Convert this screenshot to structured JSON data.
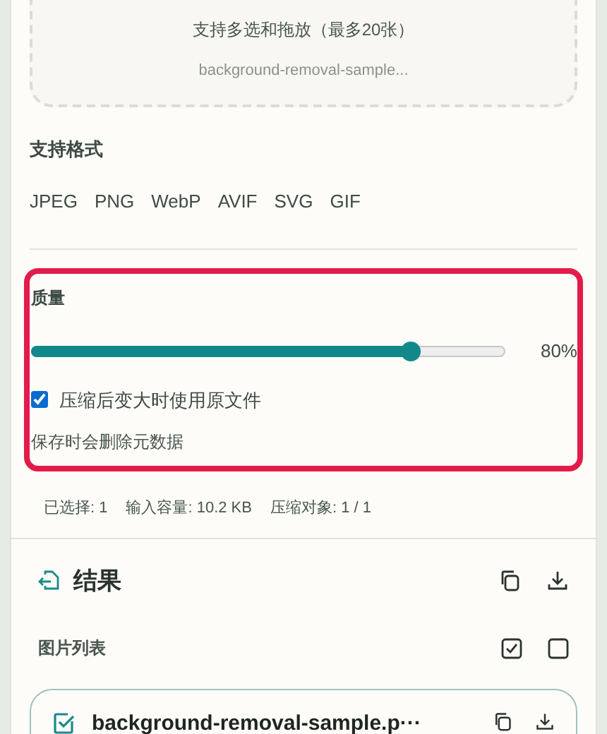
{
  "upload": {
    "hint": "支持多选和拖放（最多20张）",
    "file_name": "background-removal-sample..."
  },
  "formats": {
    "title": "支持格式",
    "items": [
      "JPEG",
      "PNG",
      "WebP",
      "AVIF",
      "SVG",
      "GIF"
    ]
  },
  "quality": {
    "title": "质量",
    "level": 0.8,
    "reading": "80%",
    "keep_original": {
      "label": "压缩后变大时使用原文件",
      "checked": true
    },
    "note": "保存时会删除元数据"
  },
  "stats": [
    "已选择: 1",
    "输入容量: 10.2 KB",
    "压缩对象: 1 / 1"
  ],
  "results": {
    "title": "结果",
    "list_title": "图片列表",
    "files": [
      {
        "name": "background-removal-sample.p···",
        "checked": true
      }
    ]
  }
}
